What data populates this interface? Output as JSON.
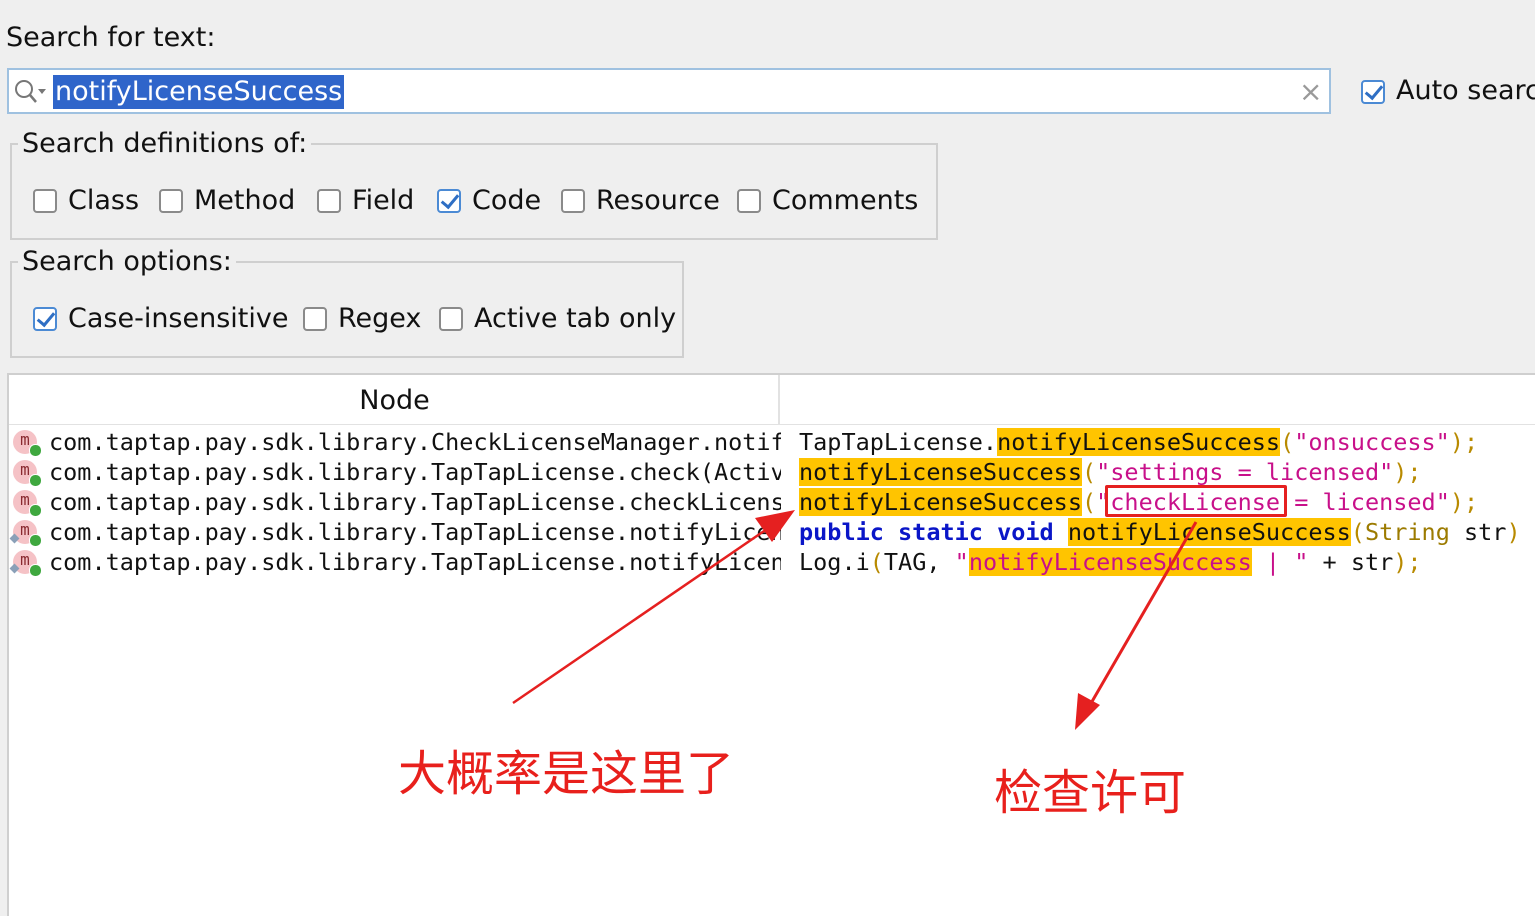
{
  "search": {
    "label": "Search for text:",
    "query": "notifyLicenseSuccess",
    "auto_search_label": "Auto searc",
    "auto_search_checked": true
  },
  "definitions": {
    "legend": "Search definitions of:",
    "options": [
      {
        "label": "Class",
        "checked": false
      },
      {
        "label": "Method",
        "checked": false
      },
      {
        "label": "Field",
        "checked": false
      },
      {
        "label": "Code",
        "checked": true
      },
      {
        "label": "Resource",
        "checked": false
      },
      {
        "label": "Comments",
        "checked": false
      }
    ]
  },
  "options": {
    "legend": "Search options:",
    "items": [
      {
        "label": "Case-insensitive",
        "checked": true
      },
      {
        "label": "Regex",
        "checked": false
      },
      {
        "label": "Active tab only",
        "checked": false
      }
    ]
  },
  "results": {
    "header_node": "Node",
    "rows": [
      {
        "icon": "m",
        "node": "com.taptap.pay.sdk.library.CheckLicenseManager.notify",
        "code": {
          "pre": "TapTapLicense.",
          "match": "notifyLicenseSuccess",
          "open": "(",
          "str": "\"onsuccess\"",
          "close": ");"
        }
      },
      {
        "icon": "m",
        "node": "com.taptap.pay.sdk.library.TapTapLicense.check(Activi",
        "code": {
          "match": "notifyLicenseSuccess",
          "open": "(",
          "str": "\"settings = licensed\"",
          "close": ");"
        }
      },
      {
        "icon": "m",
        "node": "com.taptap.pay.sdk.library.TapTapLicense.checkLicense",
        "code": {
          "match": "notifyLicenseSuccess",
          "open": "(",
          "str1": "\"",
          "boxed": "checkLicense",
          "str2": " = licensed\"",
          "close": ");"
        }
      },
      {
        "icon": "m",
        "node": "com.taptap.pay.sdk.library.TapTapLicense.notifyLicens",
        "code": {
          "kw": "public static void",
          "match": "notifyLicenseSuccess",
          "open": "(",
          "type": "String",
          "rest": " str",
          "close": ") {"
        }
      },
      {
        "icon": "m",
        "node": "com.taptap.pay.sdk.library.TapTapLicense.notifyLicens",
        "code": {
          "pre": "Log.i",
          "open": "(",
          "mid": "TAG, ",
          "strq": "\"",
          "match": "notifyLicenseSuccess",
          "str": " | \"",
          "plus": " + str",
          "close": ");"
        }
      }
    ]
  },
  "annotations": {
    "note_left": "大概率是这里了",
    "note_right": "检查许可",
    "color": "#e8201c"
  }
}
